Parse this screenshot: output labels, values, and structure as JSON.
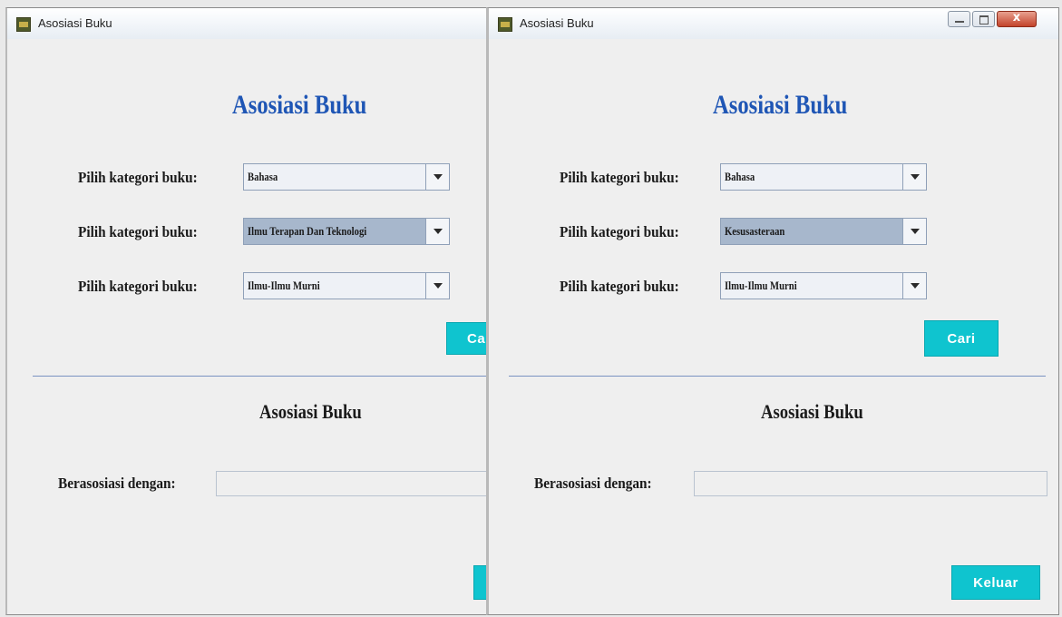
{
  "windows": [
    {
      "title": "Asosiasi Buku",
      "heading": "Asosiasi Buku",
      "rows": [
        {
          "label": "Pilih kategori buku:",
          "value": "Bahasa"
        },
        {
          "label": "Pilih kategori buku:",
          "value": "Ilmu Terapan Dan Teknologi"
        },
        {
          "label": "Pilih kategori buku:",
          "value": "Ilmu-Ilmu Murni"
        }
      ],
      "cari_label": "Ca",
      "result_heading": "Asosiasi Buku",
      "result_label": "Berasosiasi dengan:",
      "result_value": ""
    },
    {
      "title": "Asosiasi Buku",
      "heading": "Asosiasi Buku",
      "rows": [
        {
          "label": "Pilih kategori buku:",
          "value": "Bahasa"
        },
        {
          "label": "Pilih kategori buku:",
          "value": "Kesusasteraan"
        },
        {
          "label": "Pilih kategori buku:",
          "value": "Ilmu-Ilmu Murni"
        }
      ],
      "cari_label": "Cari",
      "result_heading": "Asosiasi Buku",
      "result_label": "Berasosiasi dengan:",
      "result_value": "",
      "keluar_label": "Keluar",
      "close_glyph": "x"
    }
  ],
  "colors": {
    "heading": "#1f56b5",
    "button": "#0fc4cf",
    "divider": "#7a93c1",
    "selected_combo": "#a7b7cc"
  }
}
